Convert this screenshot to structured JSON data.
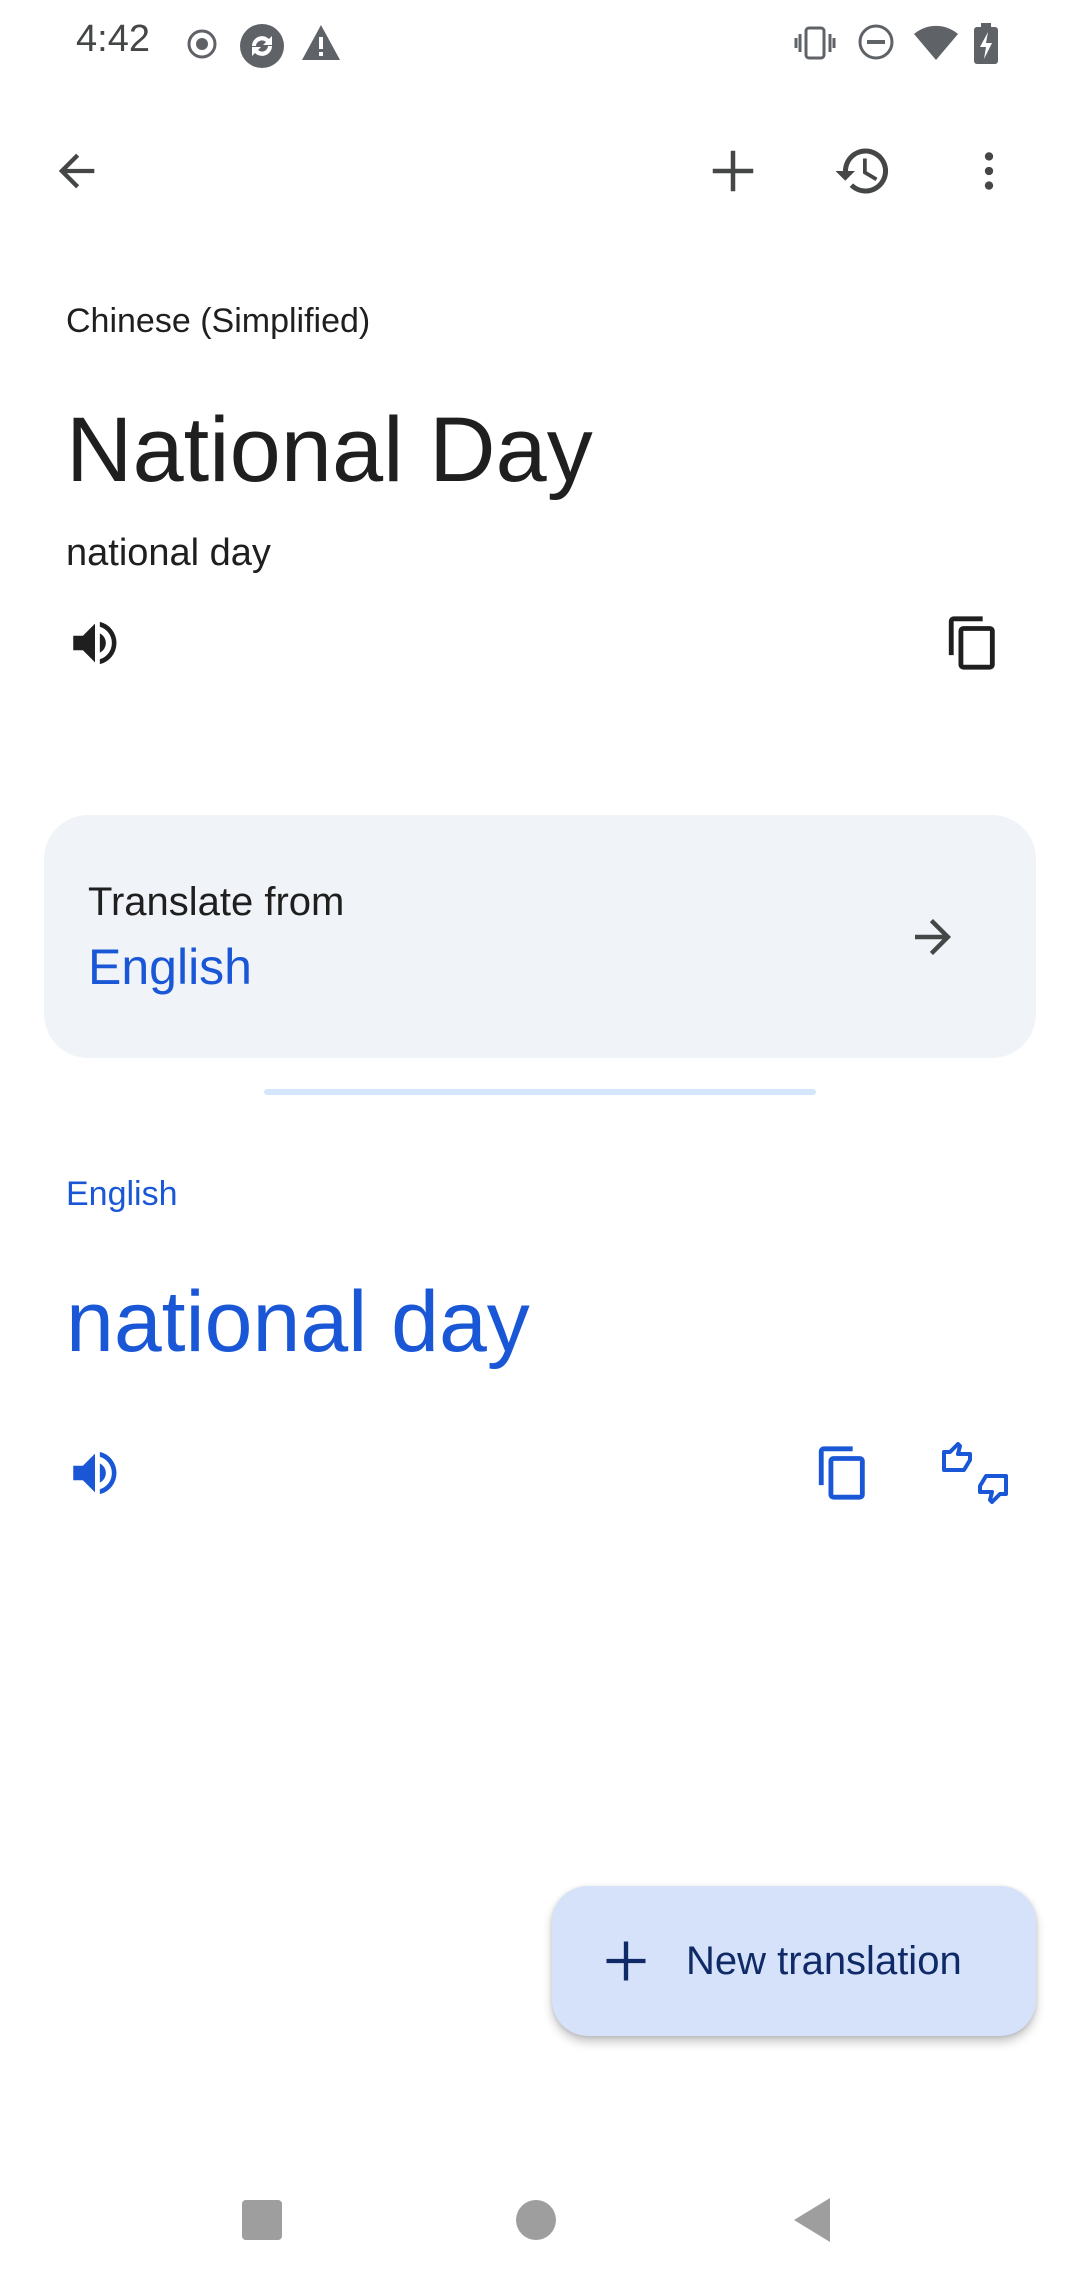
{
  "status_bar": {
    "time": "4:42",
    "icons": [
      "record-icon",
      "sync-icon",
      "warning-icon",
      "vibrate-icon",
      "dnd-icon",
      "wifi-icon",
      "battery-charging-icon"
    ]
  },
  "app_bar": {
    "actions": [
      "back-arrow-icon",
      "add-icon",
      "history-icon",
      "more-vert-icon"
    ]
  },
  "source": {
    "language": "Chinese (Simplified)",
    "text": "National Day",
    "transliteration": "national day"
  },
  "detect_card": {
    "label": "Translate from",
    "language": "English"
  },
  "target": {
    "language": "English",
    "text": "national day"
  },
  "fab": {
    "label": "New translation"
  },
  "colors": {
    "accent": "#1a57d6",
    "card_bg": "#f0f3f8",
    "fab_bg": "#d5e2f9"
  }
}
